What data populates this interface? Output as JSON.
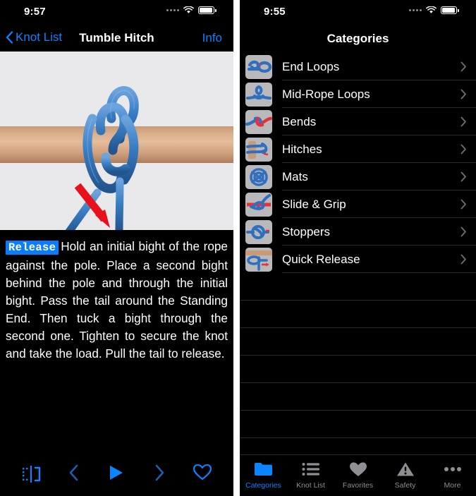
{
  "colors": {
    "accent_blue": "#0a84ff",
    "dim_blue": "#1e5fa8",
    "tag_blue": "#0a7cff",
    "background": "#000000",
    "separator": "#2a2a2c",
    "inactive_gray": "#8e8e93",
    "photo_bg": "#e9e9ec",
    "thumb_bg": "#b9b9bb",
    "rope_blue": "#2f6fc0",
    "rope_red": "#e8303c",
    "pole_tan": "#d8ad8a",
    "arrow_red": "#e8101a"
  },
  "left_screen": {
    "status": {
      "time": "9:57",
      "cellular_icon": "signal-dots-icon",
      "wifi_icon": "wifi-icon",
      "battery_icon": "battery-full-icon"
    },
    "nav": {
      "back_label": "Knot List",
      "back_icon": "chevron-left-icon",
      "title": "Tumble Hitch",
      "info_label": "Info"
    },
    "photo": {
      "name": "knot-photo",
      "alt": "Tumble Hitch knot tied in blue rope around a wooden pole with a red arrow pointing at the tail"
    },
    "description": {
      "tag": "Release",
      "body": "Hold an initial bight of the rope against the pole. Place a second bight behind the pole and through the initial bight. Pass the tail around the Standing End. Then tuck a bight through the second one. Tighten to secure the knot and take the load. Pull the tail to release."
    },
    "toolbar": [
      {
        "name": "mirror-flip-button",
        "icon": "flip-horizontal-icon",
        "state": "enabled"
      },
      {
        "name": "previous-step-button",
        "icon": "chevron-left-icon",
        "state": "dimmed"
      },
      {
        "name": "play-button",
        "icon": "play-triangle-icon",
        "state": "enabled"
      },
      {
        "name": "next-step-button",
        "icon": "chevron-right-icon",
        "state": "dimmed"
      },
      {
        "name": "favorite-button",
        "icon": "heart-outline-icon",
        "state": "enabled"
      }
    ]
  },
  "right_screen": {
    "status": {
      "time": "9:55",
      "cellular_icon": "signal-dots-icon",
      "wifi_icon": "wifi-icon",
      "battery_icon": "battery-full-icon"
    },
    "nav": {
      "title": "Categories"
    },
    "categories": [
      {
        "label": "End Loops",
        "thumb": "end-loops-thumbnail",
        "chevron": "chevron-right-icon"
      },
      {
        "label": "Mid-Rope Loops",
        "thumb": "mid-rope-loops-thumbnail",
        "chevron": "chevron-right-icon"
      },
      {
        "label": "Bends",
        "thumb": "bends-thumbnail",
        "chevron": "chevron-right-icon"
      },
      {
        "label": "Hitches",
        "thumb": "hitches-thumbnail",
        "chevron": "chevron-right-icon"
      },
      {
        "label": "Mats",
        "thumb": "mats-thumbnail",
        "chevron": "chevron-right-icon"
      },
      {
        "label": "Slide & Grip",
        "thumb": "slide-grip-thumbnail",
        "chevron": "chevron-right-icon"
      },
      {
        "label": "Stoppers",
        "thumb": "stoppers-thumbnail",
        "chevron": "chevron-right-icon"
      },
      {
        "label": "Quick Release",
        "thumb": "quick-release-thumbnail",
        "chevron": "chevron-right-icon"
      }
    ],
    "tabs": [
      {
        "label": "Categories",
        "icon": "folder-icon",
        "active": true
      },
      {
        "label": "Knot List",
        "icon": "list-bullet-icon",
        "active": false
      },
      {
        "label": "Favorites",
        "icon": "heart-filled-icon",
        "active": false
      },
      {
        "label": "Safety",
        "icon": "warning-triangle-icon",
        "active": false
      },
      {
        "label": "More",
        "icon": "ellipsis-icon",
        "active": false
      }
    ]
  }
}
